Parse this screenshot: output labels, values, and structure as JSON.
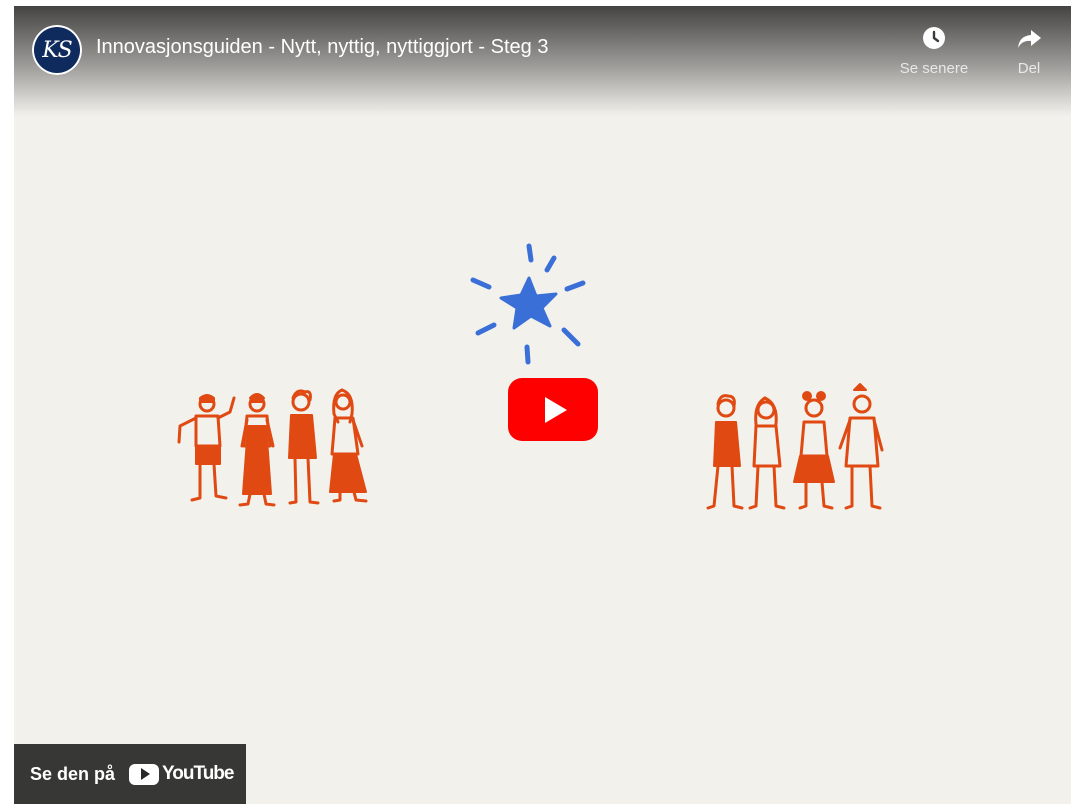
{
  "video": {
    "title": "Innovasjonsguiden - Nytt, nyttig, nyttiggjort - Steg 3",
    "channel_avatar_text": "KS"
  },
  "actions": {
    "watch_later": {
      "label": "Se senere",
      "icon": "clock-icon"
    },
    "share": {
      "label": "Del",
      "icon": "share-arrow-icon"
    }
  },
  "watch_on": {
    "label": "Se den på",
    "logo_text": "YouTube"
  },
  "colors": {
    "figure_orange": "#e04a12",
    "star_blue": "#3a6fd8",
    "play_red": "#ff0000",
    "background": "#f3f1ec"
  }
}
